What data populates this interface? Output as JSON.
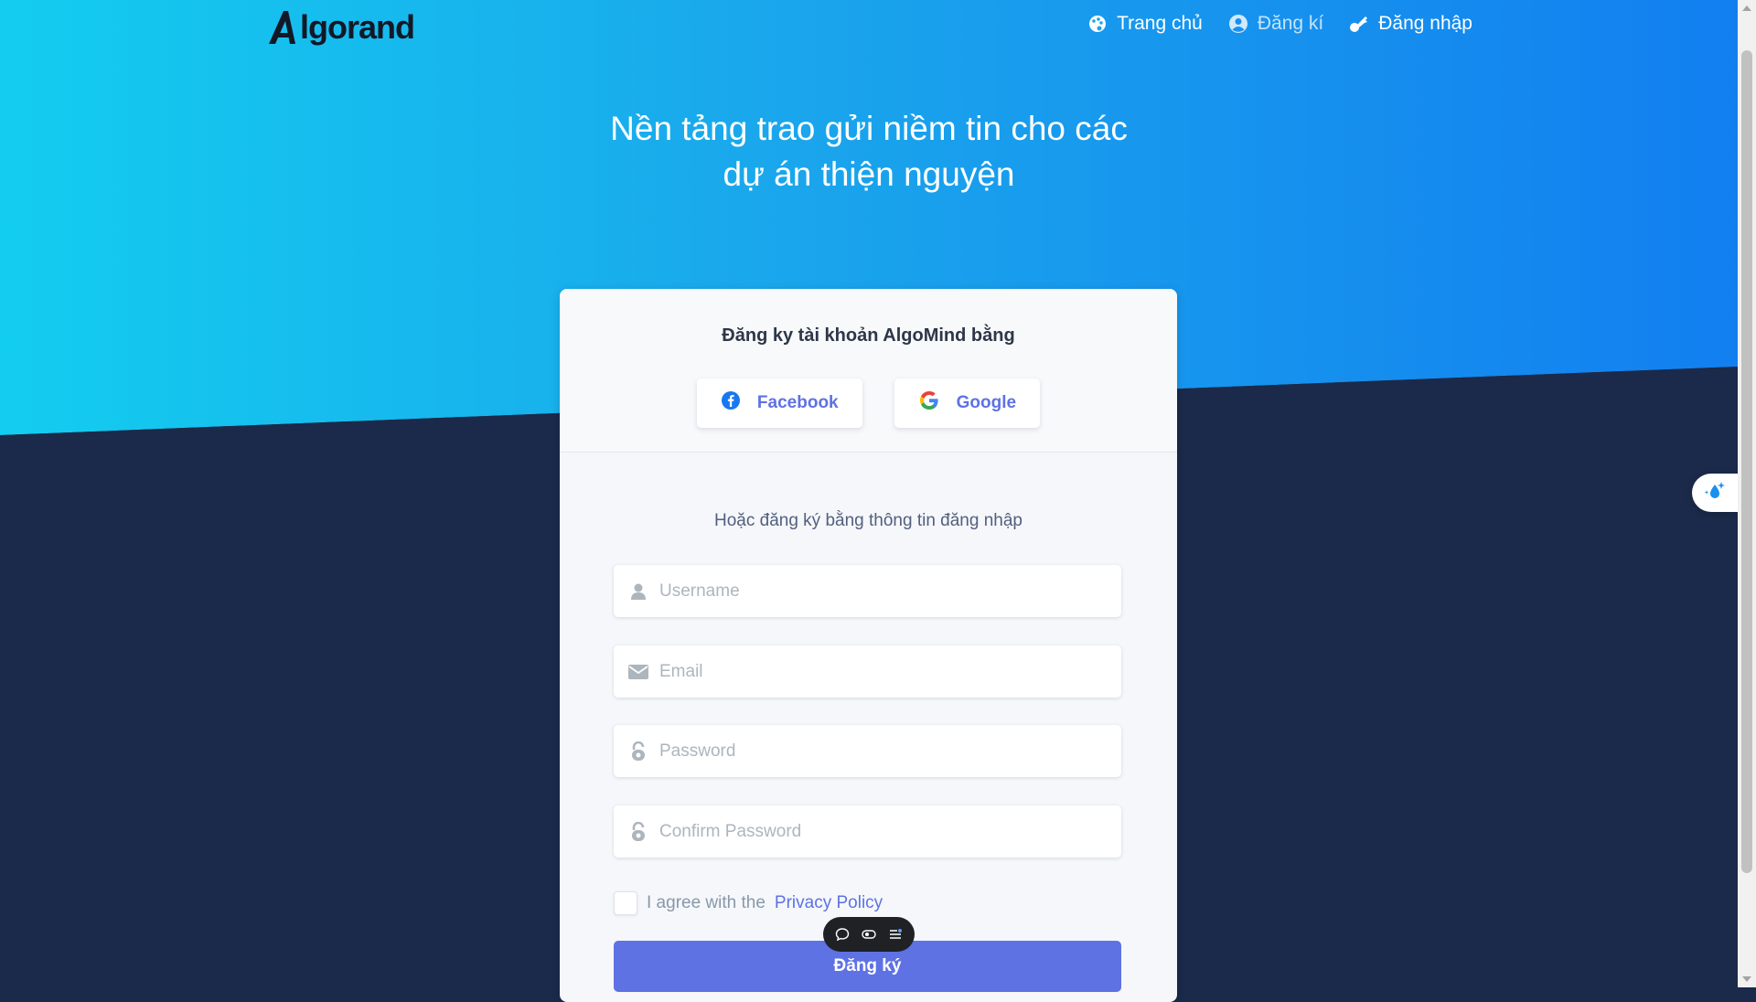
{
  "brand": {
    "logo_text": "lgorand"
  },
  "nav": {
    "home": "Trang chủ",
    "register": "Đăng kí",
    "login": "Đăng nhập"
  },
  "hero": {
    "title_line1": "Nền tảng trao gửi niềm tin cho các",
    "title_line2": "dự án thiện nguyện"
  },
  "card": {
    "heading": "Đăng ky tài khoản AlgoMind bằng",
    "facebook_label": "Facebook",
    "google_label": "Google",
    "subheading": "Hoặc đăng ký bằng thông tin đăng nhập",
    "fields": {
      "username_placeholder": "Username",
      "email_placeholder": "Email",
      "password_placeholder": "Password",
      "confirm_placeholder": "Confirm Password"
    },
    "agree_text": "I agree with the",
    "privacy_link": "Privacy Policy",
    "submit_label": "Đăng ký"
  },
  "colors": {
    "hero_start": "#13cdef",
    "hero_end": "#127ff0",
    "dark_bg": "#1b2a4a",
    "primary": "#5e72e4"
  },
  "icons": [
    "palette-icon",
    "user-circle-icon",
    "key-icon",
    "facebook-icon",
    "google-icon",
    "user-icon",
    "envelope-icon",
    "lock-icon",
    "chat-icon",
    "toggle-icon",
    "list-icon",
    "water-sparkle-icon"
  ]
}
